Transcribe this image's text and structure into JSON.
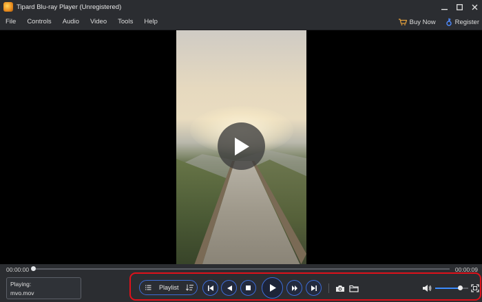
{
  "window": {
    "title": "Tipard Blu-ray Player (Unregistered)"
  },
  "menu": {
    "items": [
      "File",
      "Controls",
      "Audio",
      "Video",
      "Tools",
      "Help"
    ],
    "buy_now": "Buy Now",
    "register": "Register"
  },
  "playback": {
    "current_time": "00:00:00",
    "total_time": "00:00:09",
    "progress": 0.0,
    "playing_label": "Playing:",
    "file_name": "mvo.mov"
  },
  "controls": {
    "playlist_label": "Playlist",
    "volume": 0.75
  },
  "colors": {
    "accent": "#3d6cd7",
    "highlight": "#e0111a",
    "panel": "#2b2d31"
  }
}
